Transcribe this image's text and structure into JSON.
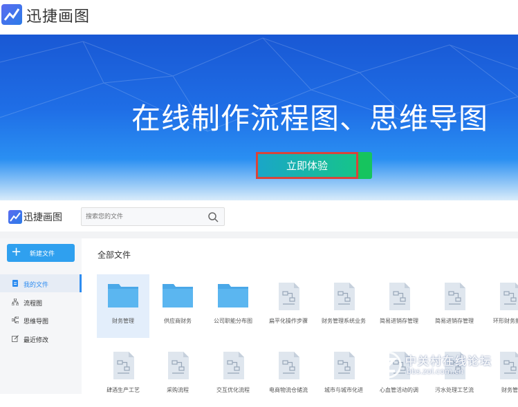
{
  "header": {
    "brand": "迅捷画图"
  },
  "banner": {
    "headline": "在线制作流程图、思维导图",
    "cta_label": "立即体验"
  },
  "app": {
    "brand": "迅捷画图",
    "search": {
      "placeholder": "搜索您的文件",
      "value": ""
    },
    "new_button": "新建文件",
    "nav": [
      {
        "label": "我的文件",
        "icon": "document-icon",
        "active": true
      },
      {
        "label": "流程图",
        "icon": "flowchart-icon",
        "active": false
      },
      {
        "label": "思维导图",
        "icon": "mindmap-icon",
        "active": false
      },
      {
        "label": "最近修改",
        "icon": "edit-icon",
        "active": false
      }
    ],
    "section_title": "全部文件",
    "files_row1": [
      {
        "name": "财务管理",
        "type": "folder"
      },
      {
        "name": "供应商财务",
        "type": "folder"
      },
      {
        "name": "公司职能分布图",
        "type": "folder"
      },
      {
        "name": "扁平化操作步骤",
        "type": "doc"
      },
      {
        "name": "财务管理系统业务",
        "type": "doc"
      },
      {
        "name": "简易进销存管理",
        "type": "doc"
      },
      {
        "name": "简易进销存管理",
        "type": "doc"
      },
      {
        "name": "环形财务报核",
        "type": "doc"
      }
    ],
    "files_row2": [
      {
        "name": "肆酒生产工艺",
        "type": "doc"
      },
      {
        "name": "采购流程",
        "type": "doc"
      },
      {
        "name": "交互优化流程",
        "type": "doc"
      },
      {
        "name": "电商物流仓储流",
        "type": "doc"
      },
      {
        "name": "城市与城市化进",
        "type": "doc"
      },
      {
        "name": "心血管活动的调",
        "type": "doc"
      },
      {
        "name": "污水处理工艺流",
        "type": "doc"
      },
      {
        "name": "财务管",
        "type": "doc"
      }
    ]
  },
  "watermark": {
    "line1": "中关村在线论坛",
    "line2": "bbs.zol.com.cn"
  },
  "colors": {
    "accent": "#2d8cf0",
    "cta_start": "#1aa6c8",
    "cta_end": "#16c48a",
    "folder": "#4aa8e8"
  }
}
